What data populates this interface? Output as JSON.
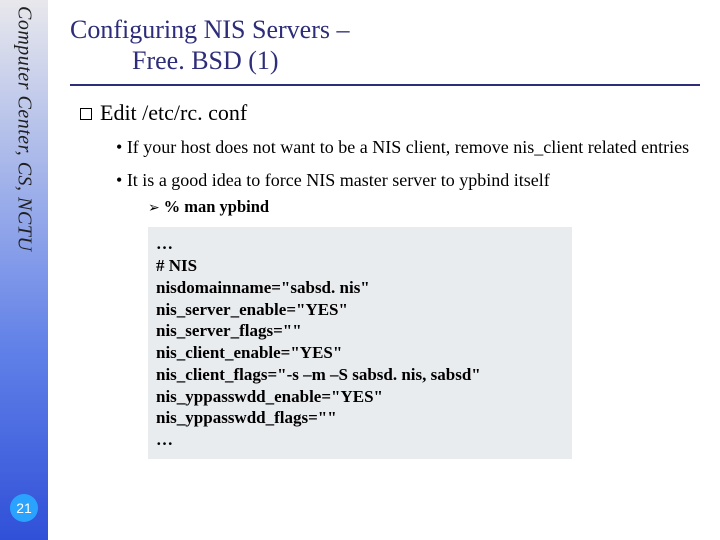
{
  "sidebar": {
    "label": "Computer Center, CS, NCTU"
  },
  "page_number": "21",
  "title": {
    "line1": "Configuring NIS Servers –",
    "line2": "Free. BSD (1)"
  },
  "content": {
    "lvl1": "Edit /etc/rc. conf",
    "bullet1": "If your host does not want to be a NIS client, remove nis_client related entries",
    "bullet2": "It is a good idea to force NIS master server to ypbind itself",
    "sub1": "% man ypbind"
  },
  "code": {
    "l0": "…",
    "l1": "# NIS",
    "l2": "nisdomainname=\"sabsd. nis\"",
    "l3": "nis_server_enable=\"YES\"",
    "l4": "nis_server_flags=\"\"",
    "l5": "nis_client_enable=\"YES\"",
    "l6": "nis_client_flags=\"-s –m –S sabsd. nis, sabsd\"",
    "l7": "nis_yppasswdd_enable=\"YES\"",
    "l8": "nis_yppasswdd_flags=\"\"",
    "l9": "…"
  }
}
